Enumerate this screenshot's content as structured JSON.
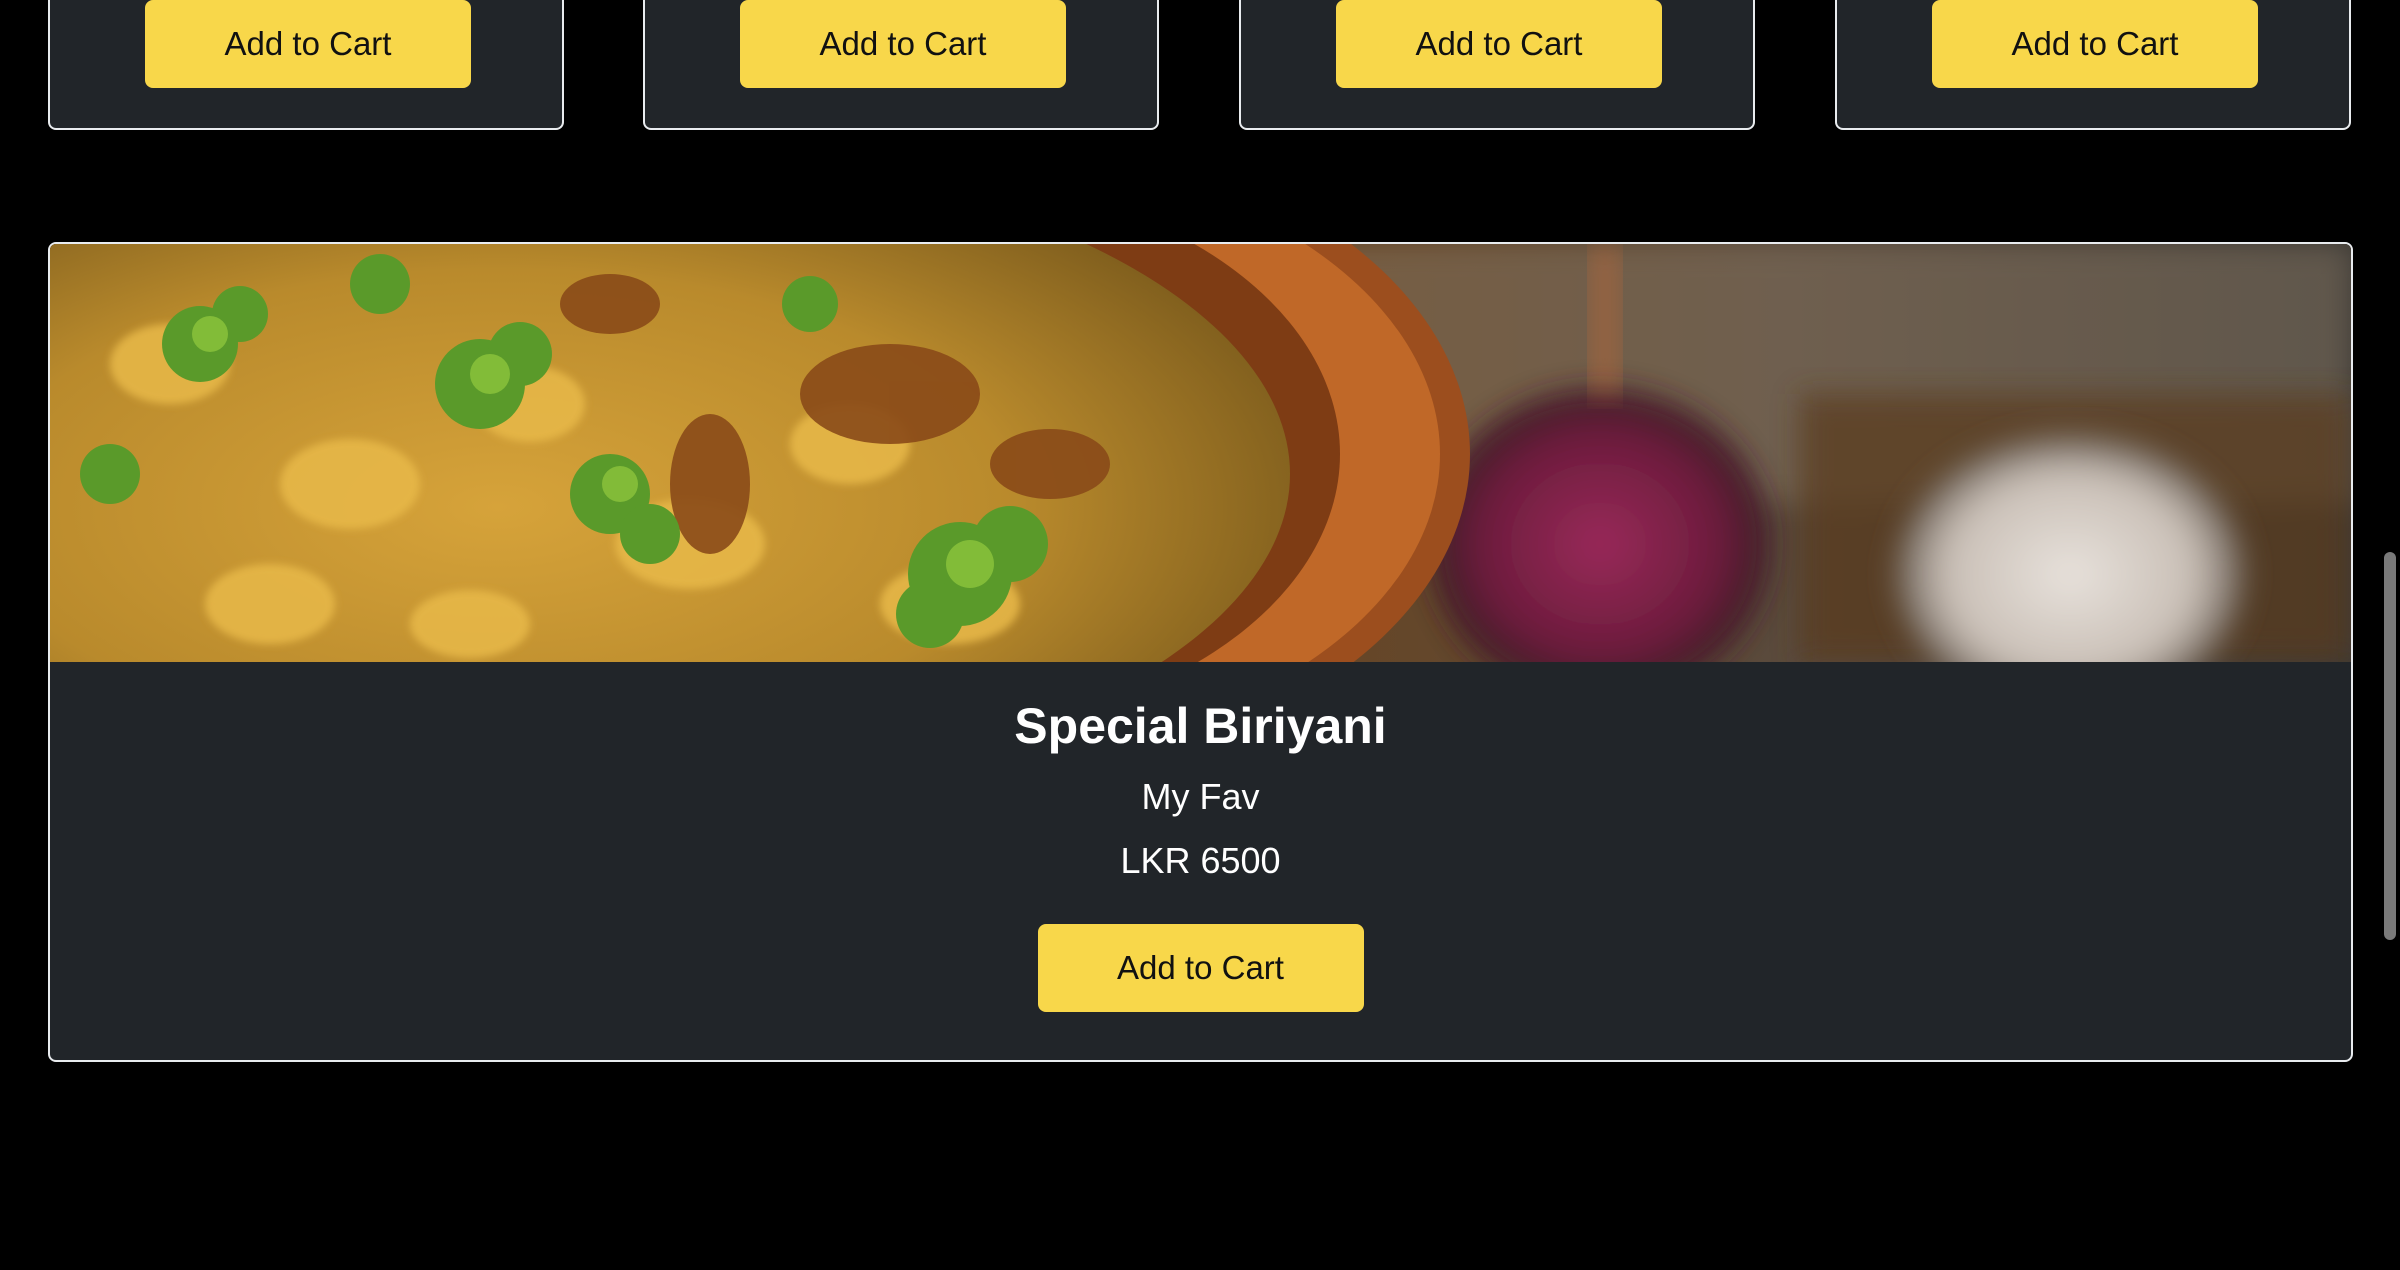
{
  "top_cards": [
    {
      "button_label": "Add to Cart"
    },
    {
      "button_label": "Add to Cart"
    },
    {
      "button_label": "Add to Cart"
    },
    {
      "button_label": "Add to Cart"
    }
  ],
  "featured": {
    "title": "Special Biriyani",
    "description": "My Fav",
    "price": "LKR 6500",
    "button_label": "Add to Cart",
    "image_icon": "food-photo"
  },
  "colors": {
    "background": "#000000",
    "card": "#212529",
    "card_border": "#e9ecef",
    "button": "#f8d74a",
    "button_text": "#111111",
    "text": "#ffffff"
  }
}
